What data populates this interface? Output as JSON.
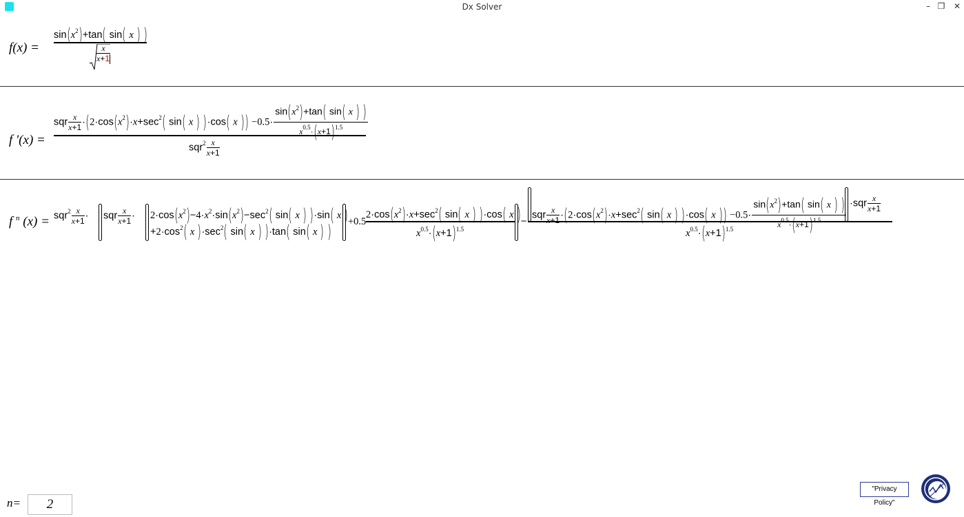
{
  "window": {
    "title": "Dx Solver",
    "minimize": "–",
    "restore": "❐",
    "close": "✕"
  },
  "labels": {
    "f": "f(x)  =",
    "f1": "f ′(x)  =",
    "fn": "f ",
    "fn_sup": "n",
    "fn_rest": " (x)  =",
    "n": "n="
  },
  "n_value": "2",
  "privacy_label": "\"Privacy Policy\"",
  "accent_color": "#19e3e8",
  "logo_color": "#1e2f7a",
  "icons": [
    "app-icon",
    "minimize-icon",
    "restore-icon",
    "close-icon",
    "logo-icon"
  ]
}
